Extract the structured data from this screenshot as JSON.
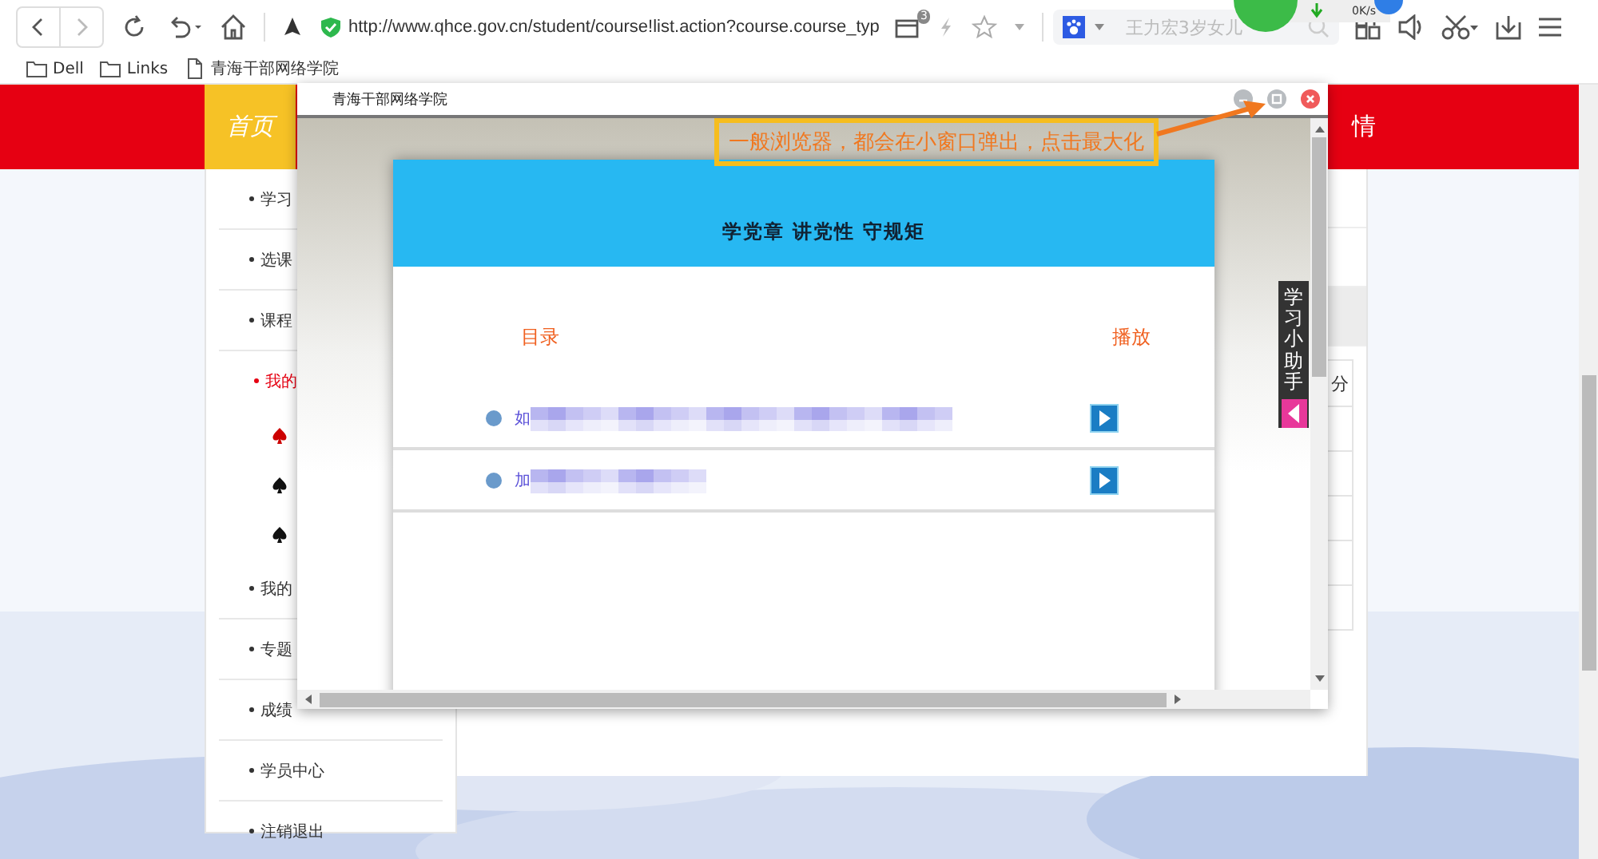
{
  "browser": {
    "url": "http://www.qhce.gov.cn/student/course!list.action?course.course_typ",
    "tab_badge": "3",
    "search_placeholder": "王力宏3岁女儿",
    "speed": "0K/s"
  },
  "bookmarks": [
    {
      "label": "Dell",
      "kind": "folder"
    },
    {
      "label": "Links",
      "kind": "folder"
    },
    {
      "label": "青海干部网络学院",
      "kind": "page"
    }
  ],
  "site": {
    "home": "首页",
    "banner_right": "情",
    "nav": [
      {
        "label": "学习",
        "selected": false
      },
      {
        "label": "选课",
        "selected": false
      },
      {
        "label": "课程",
        "selected": false
      },
      {
        "label": "我的",
        "selected": true,
        "children": [
          {
            "selected": true
          },
          {
            "selected": false
          },
          {
            "selected": false
          }
        ]
      },
      {
        "label": "我的",
        "selected": false
      },
      {
        "label": "专题",
        "selected": false
      },
      {
        "label": "成绩",
        "selected": false
      },
      {
        "label": "学员中心",
        "selected": false
      },
      {
        "label": "注销退出",
        "selected": false
      }
    ],
    "table": {
      "column_header": "分"
    }
  },
  "popup": {
    "title": "青海干部网络学院",
    "card_title": "学党章 讲党性 守规矩",
    "columns": [
      "目录",
      "播放"
    ],
    "rows": [
      {
        "text": "如"
      },
      {
        "text": "加"
      }
    ]
  },
  "helper": {
    "label": "学习小助手"
  },
  "annotation": {
    "text": "一般浏览器，都会在小窗口弹出，点击最大化"
  }
}
